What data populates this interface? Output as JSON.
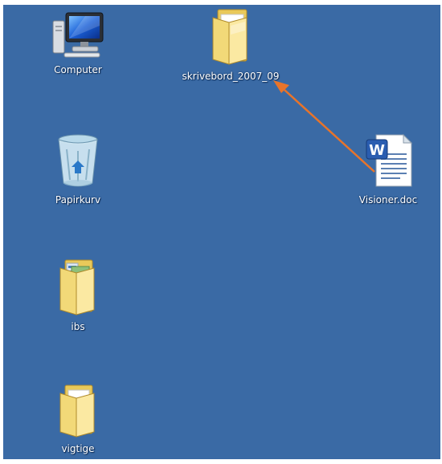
{
  "desktop": {
    "background_color": "#3a6aa5",
    "icons": [
      {
        "label": "Computer",
        "icon": "computer-icon"
      },
      {
        "label": "skrivebord_2007_09",
        "icon": "folder-icon"
      },
      {
        "label": "Papirkurv",
        "icon": "recycle-bin-icon"
      },
      {
        "label": "Visioner.doc",
        "icon": "word-document-icon"
      },
      {
        "label": "ibs",
        "icon": "folder-icon"
      },
      {
        "label": "vigtige",
        "icon": "folder-icon"
      }
    ]
  },
  "annotation": {
    "color": "#e8742a",
    "meaning": "drag Visioner.doc onto skrivebord_2007_09 folder"
  }
}
